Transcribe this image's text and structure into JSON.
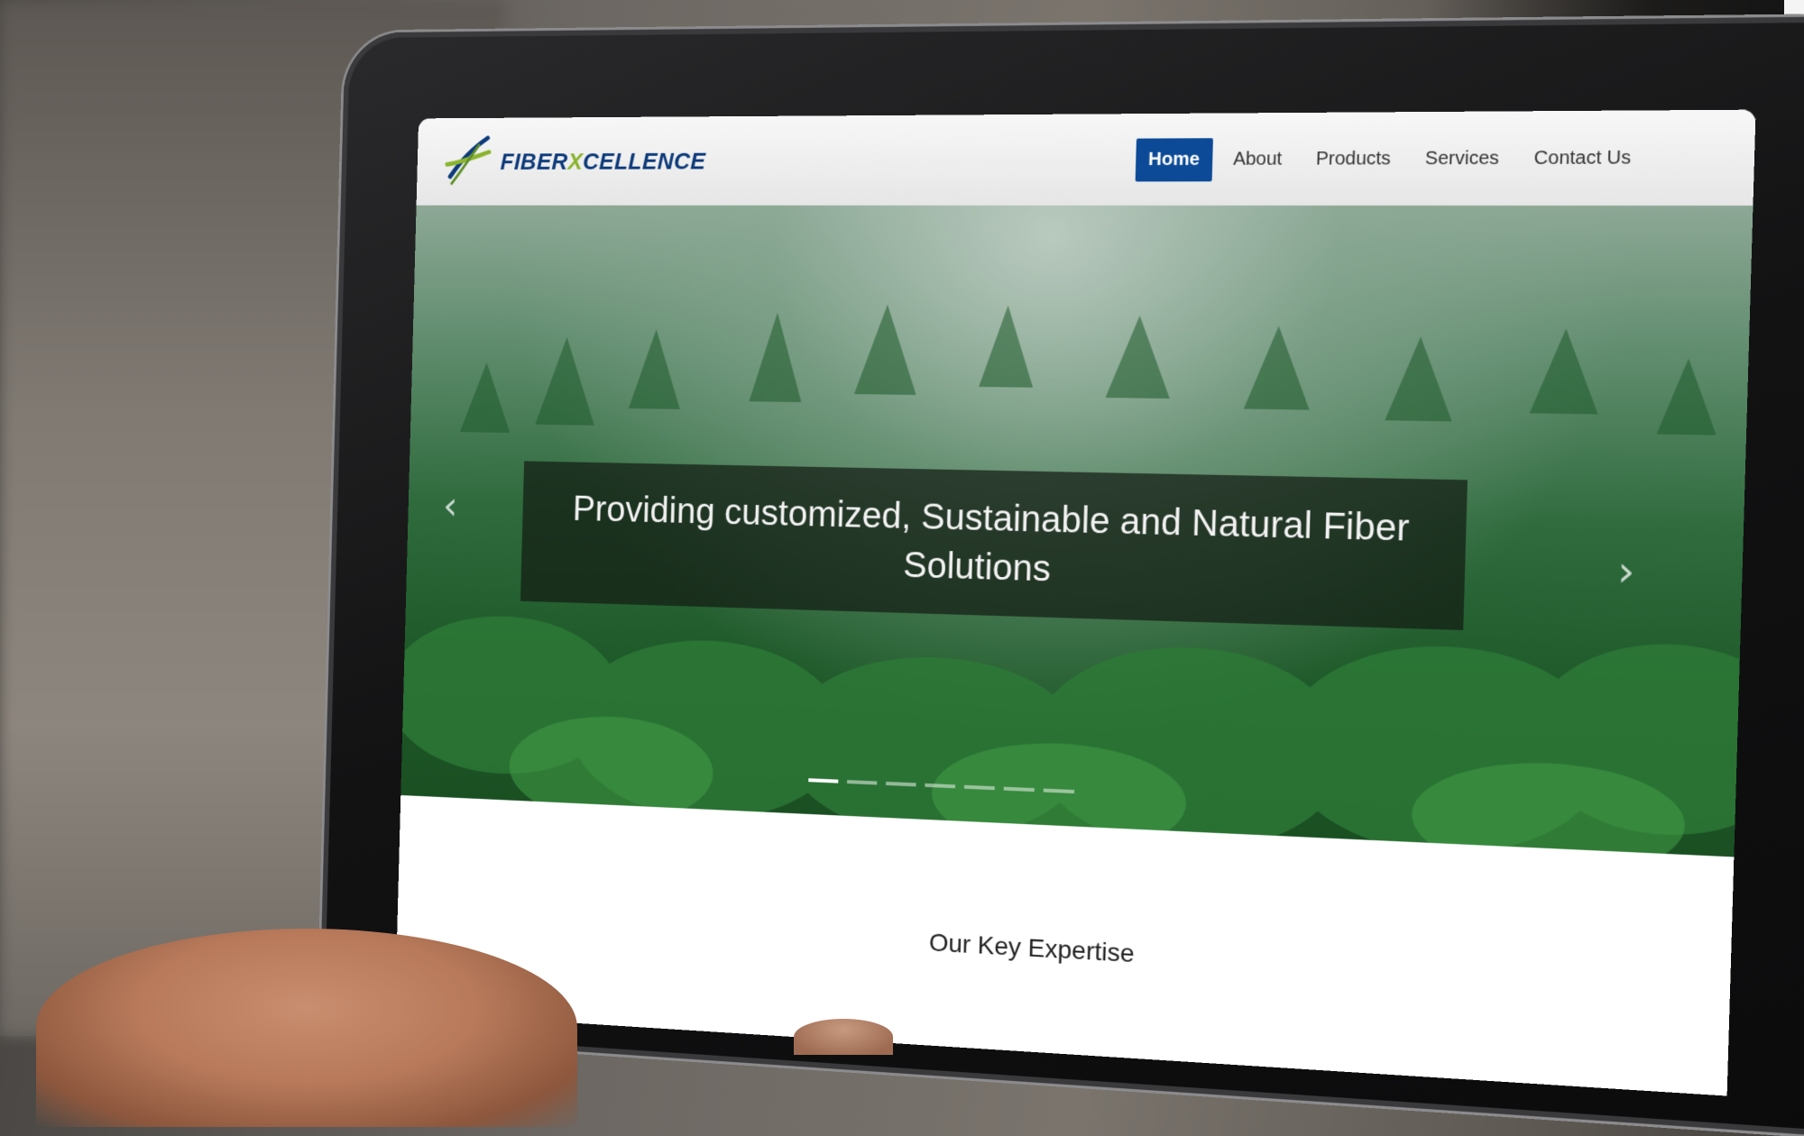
{
  "logo": {
    "text_main": "FIBER",
    "text_x": "X",
    "text_tail": "CELLENCE"
  },
  "nav": {
    "items": [
      {
        "label": "Home",
        "active": true
      },
      {
        "label": "About",
        "active": false
      },
      {
        "label": "Products",
        "active": false
      },
      {
        "label": "Services",
        "active": false
      },
      {
        "label": "Contact Us",
        "active": false
      }
    ]
  },
  "hero": {
    "caption": "Providing customized, Sustainable and Natural Fiber Solutions",
    "prev_icon": "chevron-left-icon",
    "next_icon": "chevron-right-icon",
    "slide_count": 7,
    "active_slide": 1
  },
  "section": {
    "title": "Our Key Expertise"
  },
  "colors": {
    "brand_blue": "#0c4a97",
    "brand_green": "#8ab42e",
    "logo_navy": "#0d3a7a"
  }
}
